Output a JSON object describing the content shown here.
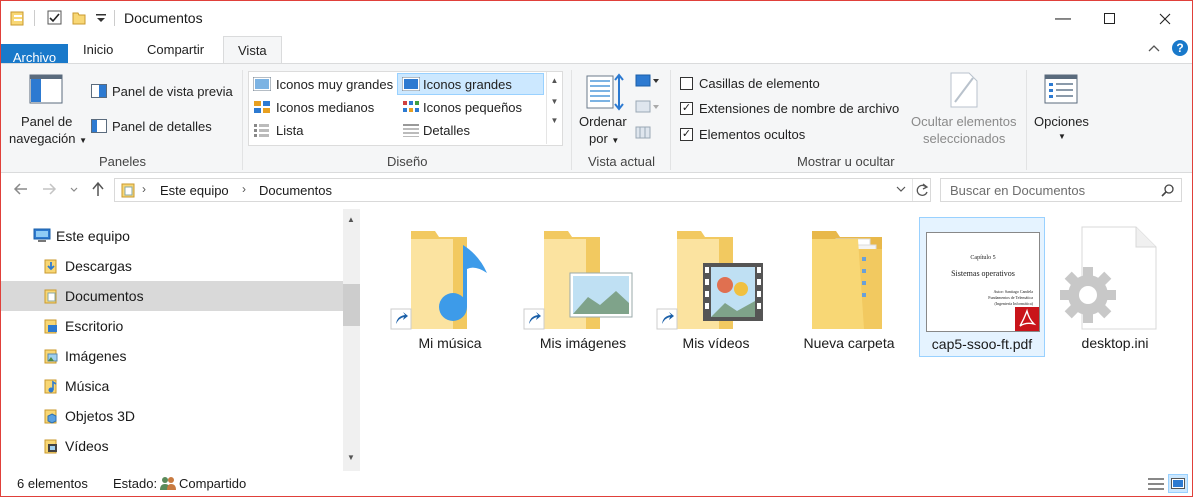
{
  "window": {
    "title": "Documentos"
  },
  "tabs": [
    {
      "label": "Archivo"
    },
    {
      "label": "Inicio"
    },
    {
      "label": "Compartir"
    },
    {
      "label": "Vista"
    }
  ],
  "ribbon": {
    "panes": {
      "navigation_line1": "Panel de",
      "navigation_line2": "navegación",
      "preview": "Panel de vista previa",
      "details": "Panel de detalles",
      "group": "Paneles"
    },
    "layout": {
      "items": [
        "Iconos muy grandes",
        "Iconos grandes",
        "Iconos medianos",
        "Iconos pequeños",
        "Lista",
        "Detalles"
      ],
      "selected": "Iconos grandes",
      "group": "Diseño"
    },
    "current_view": {
      "sort_line1": "Ordenar",
      "sort_line2": "por",
      "group": "Vista actual"
    },
    "show_hide": {
      "checkboxes": [
        {
          "label": "Casillas de elemento",
          "checked": false
        },
        {
          "label": "Extensiones de nombre de archivo",
          "checked": true
        },
        {
          "label": "Elementos ocultos",
          "checked": true
        }
      ],
      "hide_line1": "Ocultar elementos",
      "hide_line2": "seleccionados",
      "group": "Mostrar u ocultar"
    },
    "options": {
      "label": "Opciones"
    }
  },
  "address": {
    "crumbs": [
      "Este equipo",
      "Documentos"
    ],
    "search_placeholder": "Buscar en Documentos"
  },
  "nav": [
    {
      "label": "Este equipo",
      "icon": "computer-icon"
    },
    {
      "label": "Descargas",
      "icon": "downloads-icon"
    },
    {
      "label": "Documentos",
      "icon": "documents-icon",
      "selected": true
    },
    {
      "label": "Escritorio",
      "icon": "desktop-icon"
    },
    {
      "label": "Imágenes",
      "icon": "pictures-icon"
    },
    {
      "label": "Música",
      "icon": "music-icon"
    },
    {
      "label": "Objetos 3D",
      "icon": "objects3d-icon"
    },
    {
      "label": "Vídeos",
      "icon": "videos-icon"
    }
  ],
  "files": [
    {
      "name": "Mi música",
      "type": "shortcut-music"
    },
    {
      "name": "Mis imágenes",
      "type": "shortcut-pictures"
    },
    {
      "name": "Mis vídeos",
      "type": "shortcut-videos"
    },
    {
      "name": "Nueva carpeta",
      "type": "folder"
    },
    {
      "name": "cap5-ssoo-ft.pdf",
      "type": "pdf",
      "selected": true,
      "thumb": {
        "chapter": "Capítulo 5",
        "title": "Sistemas operativos",
        "author": "Autor: Santiago Candela",
        "dept": "Fundamentos de Telemática",
        "school": "(Ingeniería Informática)"
      }
    },
    {
      "name": "desktop.ini",
      "type": "settings"
    }
  ],
  "status": {
    "count": "6 elementos",
    "state_label": "Estado:",
    "state_value": "Compartido"
  },
  "colors": {
    "accent": "#1979ca",
    "folder": "#f8d775",
    "folder_dark": "#e8b84a",
    "selection": "#cce8ff"
  }
}
